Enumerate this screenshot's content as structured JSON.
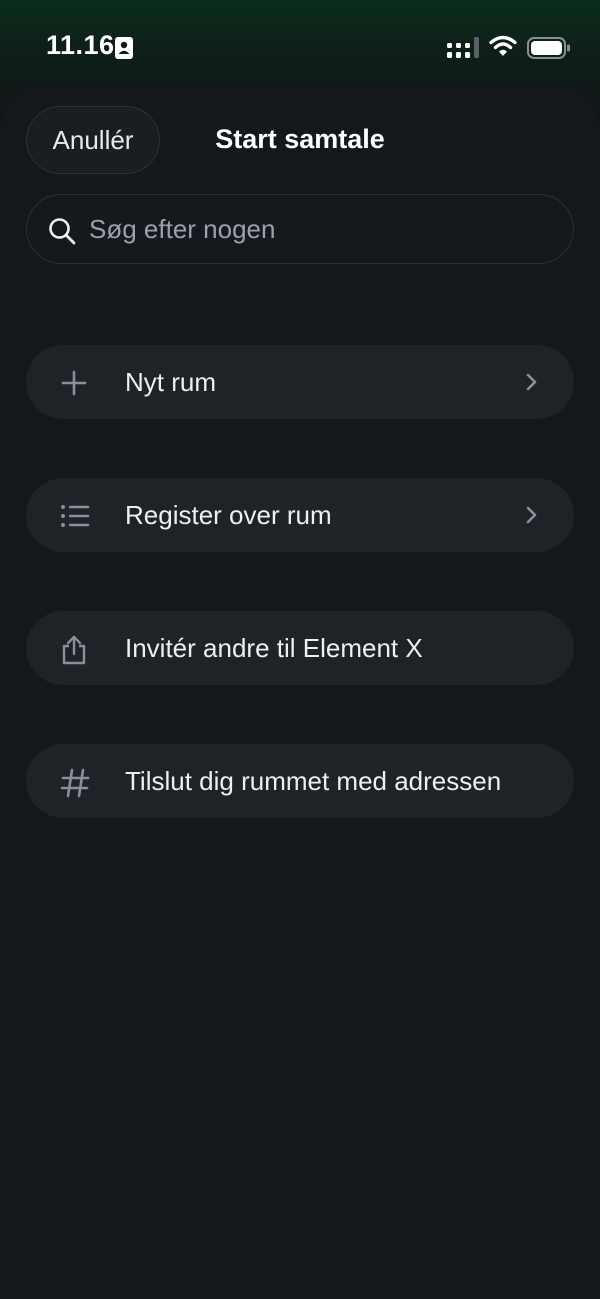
{
  "status_bar": {
    "time": "11.16"
  },
  "header": {
    "cancel_label": "Anullér",
    "title": "Start samtale"
  },
  "search": {
    "placeholder": "Søg efter nogen",
    "value": ""
  },
  "menu": {
    "items": [
      {
        "label": "Nyt rum",
        "icon": "plus-icon",
        "has_chevron": true
      },
      {
        "label": "Register over rum",
        "icon": "list-icon",
        "has_chevron": true
      },
      {
        "label": "Invitér andre til Element X",
        "icon": "share-icon",
        "has_chevron": false
      },
      {
        "label": "Tilslut dig rummet med adressen",
        "icon": "hash-icon",
        "has_chevron": false
      }
    ]
  },
  "colors": {
    "background": "#101418",
    "card": "#1f2227",
    "text": "#eceff3",
    "muted_icon": "#8a9099"
  }
}
